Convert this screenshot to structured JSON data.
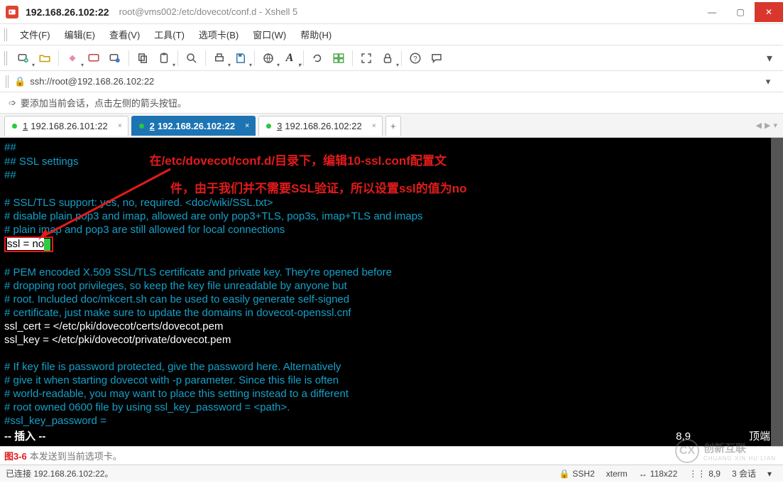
{
  "title": {
    "host": "192.168.26.102:22",
    "path": "root@vms002:/etc/dovecot/conf.d - Xshell 5"
  },
  "win": {
    "min": "—",
    "max": "▢",
    "close": "✕"
  },
  "menu": [
    "文件(F)",
    "编辑(E)",
    "查看(V)",
    "工具(T)",
    "选项卡(B)",
    "窗口(W)",
    "帮助(H)"
  ],
  "addr": "ssh://root@192.168.26.102:22",
  "hint": "要添加当前会话，点击左侧的箭头按钮。",
  "tabs": [
    {
      "num": "1",
      "label": "192.168.26.101:22",
      "active": false
    },
    {
      "num": "2",
      "label": "192.168.26.102:22",
      "active": true
    },
    {
      "num": "3",
      "label": "192.168.26.102:22",
      "active": false
    }
  ],
  "tab_add": "+",
  "annot": {
    "l1": "在/etc/dovecot/conf.d/目录下，编辑10-ssl.conf配置文",
    "l2": "件，由于我们并不需要SSL验证，所以设置ssl的值为no"
  },
  "term": {
    "l01": "##",
    "l02": "## SSL settings",
    "l03": "##",
    "l04": "# SSL/TLS support: yes, no, required. <doc/wiki/SSL.txt>",
    "l05": "# disable plain pop3 and imap, allowed are only pop3+TLS, pop3s, imap+TLS and imaps",
    "l06": "# plain imap and pop3 are still allowed for local connections",
    "ssl_pre": "ssl = ",
    "ssl_val": "no",
    "l08": "# PEM encoded X.509 SSL/TLS certificate and private key. They're opened before",
    "l09": "# dropping root privileges, so keep the key file unreadable by anyone but",
    "l10": "# root. Included doc/mkcert.sh can be used to easily generate self-signed",
    "l11": "# certificate, just make sure to update the domains in dovecot-openssl.cnf",
    "l12": "ssl_cert = </etc/pki/dovecot/certs/dovecot.pem",
    "l13": "ssl_key = </etc/pki/dovecot/private/dovecot.pem",
    "l14": "# If key file is password protected, give the password here. Alternatively",
    "l15": "# give it when starting dovecot with -p parameter. Since this file is often",
    "l16": "# world-readable, you may want to place this setting instead to a different",
    "l17": "# root owned 0600 file by using ssl_key_password = <path>.",
    "l18": "#ssl_key_password =",
    "insert": "-- 插入 --",
    "pos": "8,9",
    "top": "顶端"
  },
  "input": {
    "fig": "图3-6",
    "placeholder": "本发送到当前选项卡。"
  },
  "status": {
    "conn": "已连接 192.168.26.102:22。",
    "proto": "SSH2",
    "term": "xterm",
    "size": "118x22",
    "pos": "8,9",
    "sess": "3 会话"
  },
  "wm": {
    "l1": "创新互联",
    "l2": "CHUANG XIN HU LIAN"
  }
}
